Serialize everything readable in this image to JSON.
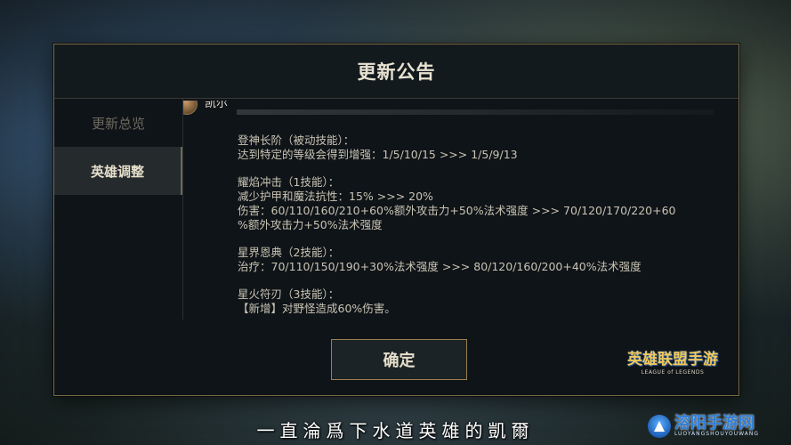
{
  "dialog": {
    "title": "更新公告",
    "confirm_label": "确定"
  },
  "sidebar": {
    "items": [
      {
        "label": "更新总览",
        "active": false
      },
      {
        "label": "英雄调整",
        "active": true
      }
    ]
  },
  "content": {
    "hero_name": "凯尔",
    "skills": [
      {
        "title": "登神长阶（被动技能）：",
        "lines": [
          "达到特定的等级会得到增强：1/5/10/15  >>>  1/5/9/13"
        ]
      },
      {
        "title": "耀焰冲击（1技能）：",
        "lines": [
          "减少护甲和魔法抗性：15%  >>>  20%",
          "伤害：60/110/160/210+60%额外攻击力+50%法术强度  >>>  70/120/170/220+60",
          "%额外攻击力+50%法术强度"
        ]
      },
      {
        "title": "星界恩典（2技能）：",
        "lines": [
          "治疗：70/110/150/190+30%法术强度  >>>  80/120/160/200+40%法术强度"
        ]
      },
      {
        "title": "星火符刃（3技能）：",
        "lines": [
          "【新增】对野怪造成60%伤害。"
        ]
      }
    ]
  },
  "brand": {
    "name": "英雄联盟手游",
    "sub": "LEAGUE of LEGENDS"
  },
  "subtitle": "一直淪爲下水道英雄的凱爾",
  "watermark": {
    "name": "溶阳手游网",
    "sub": "LUOYANGSHOUYOUWANG"
  }
}
